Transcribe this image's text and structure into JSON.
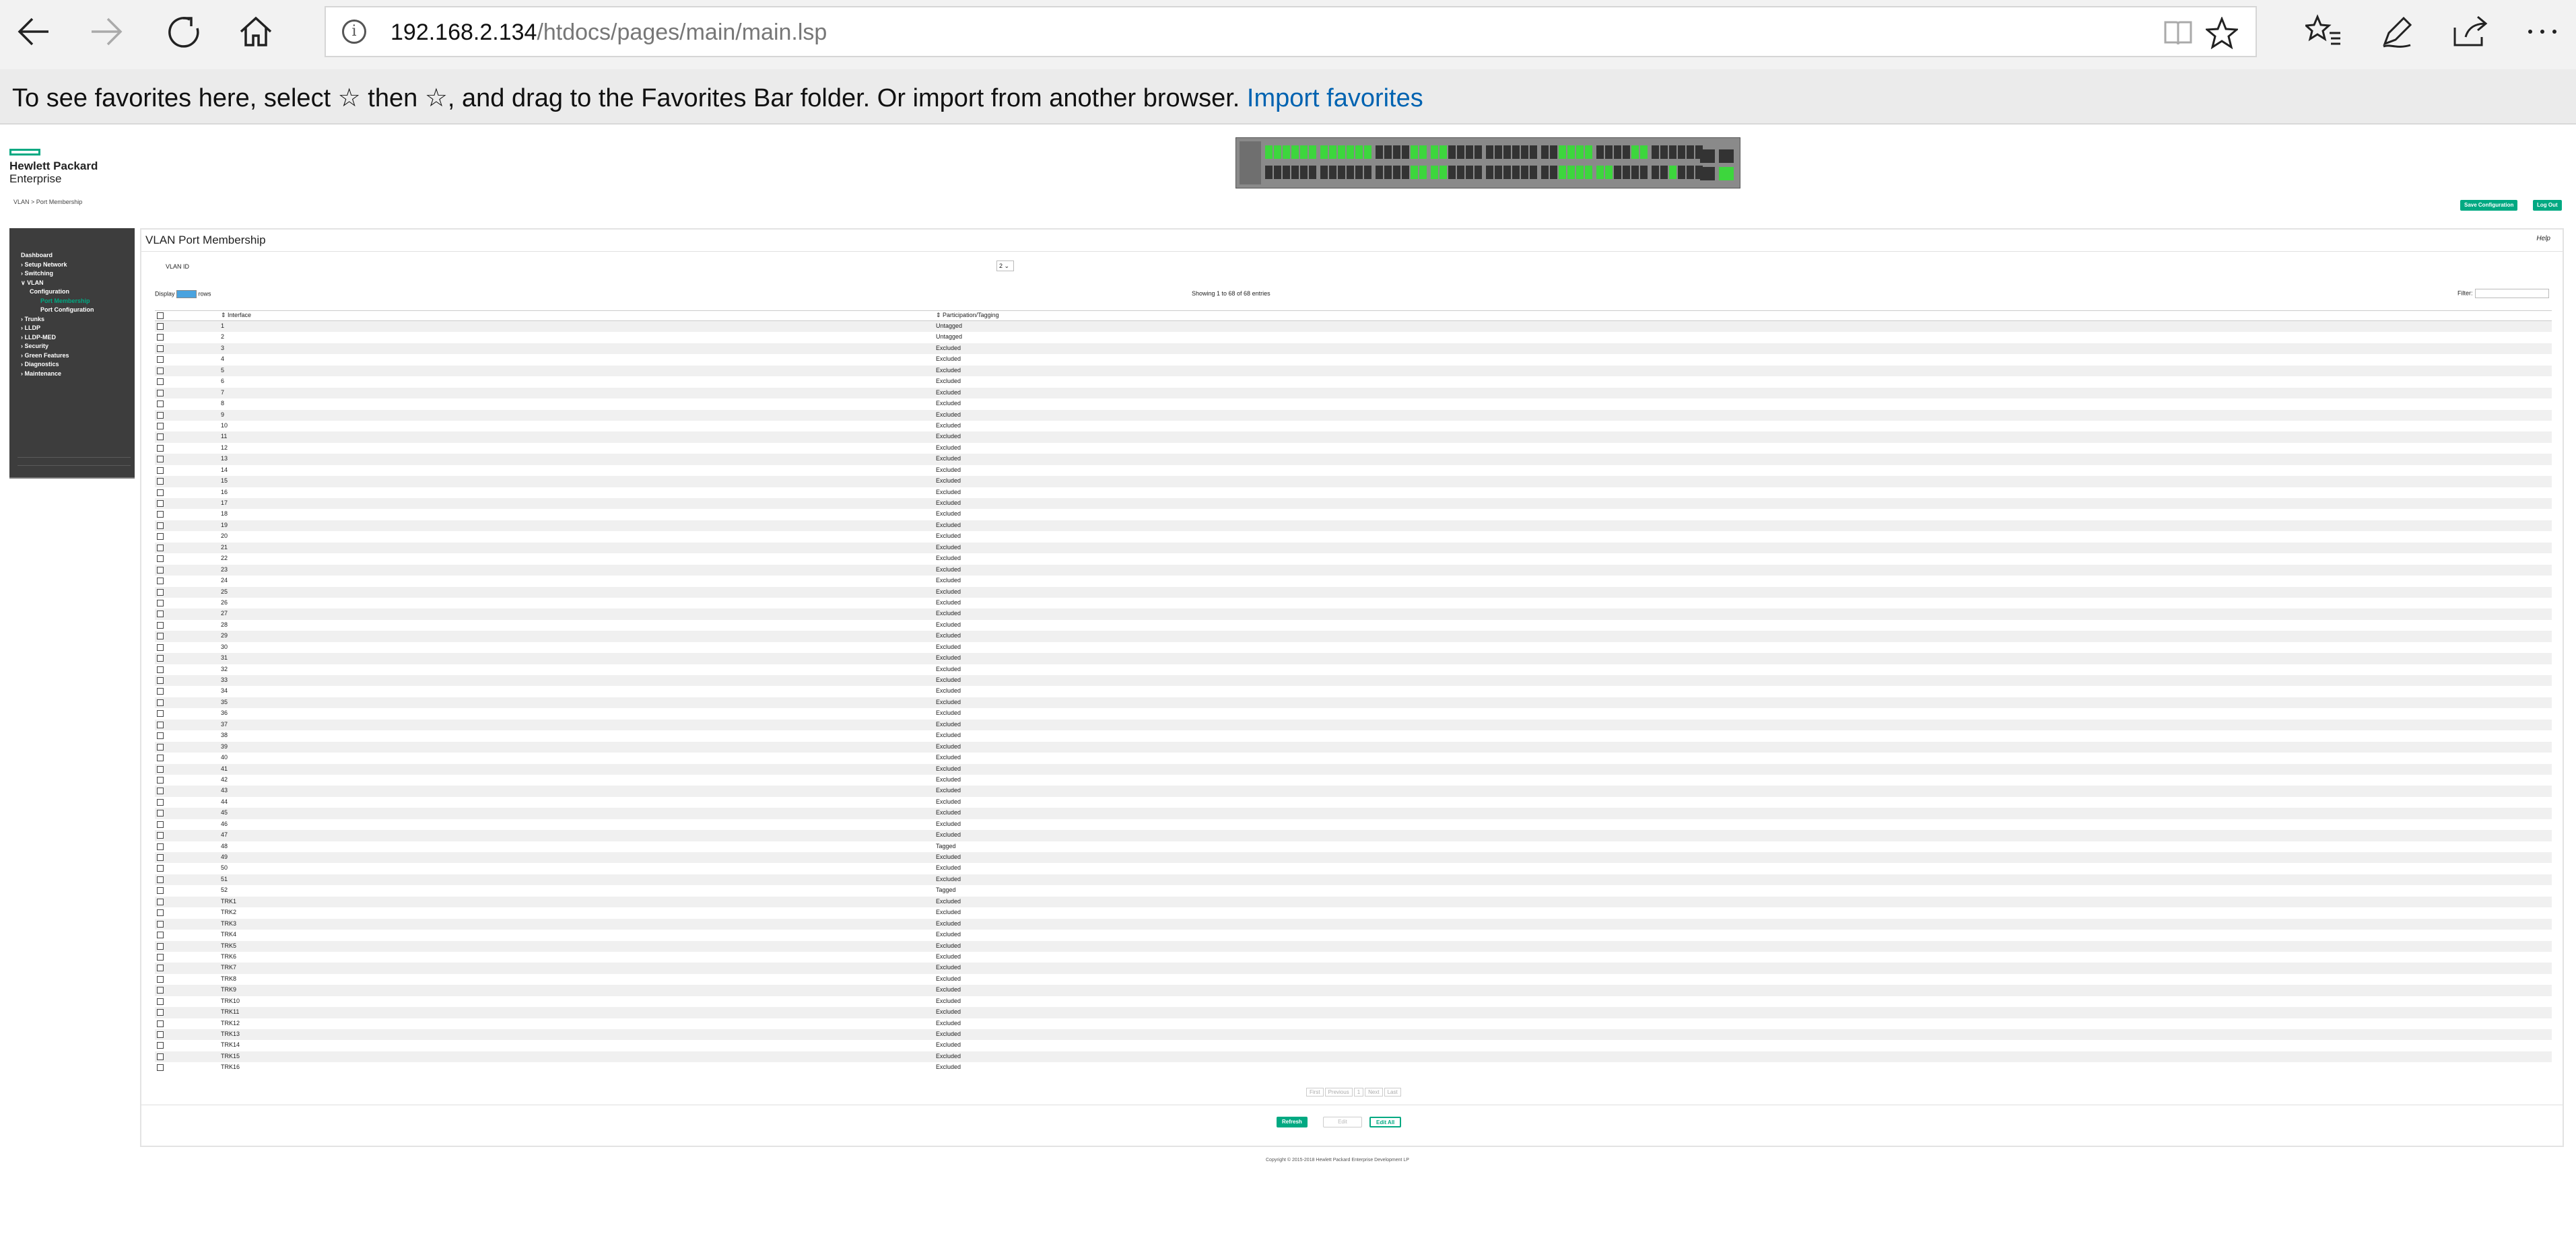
{
  "browser": {
    "url_host": "192.168.2.134",
    "url_path": "/htdocs/pages/main/main.lsp",
    "favorites_message": "To see favorites here, select ☆ then ☆, and drag to the Favorites Bar folder. Or import from another browser.",
    "import_link": "Import favorites"
  },
  "header": {
    "logo_line1": "Hewlett Packard",
    "logo_line2": "Enterprise",
    "breadcrumb": "VLAN > Port Membership",
    "save_button": "Save Configuration",
    "logout_button": "Log Out"
  },
  "sidebar": {
    "items": [
      {
        "label": "Dashboard",
        "level": 0
      },
      {
        "label": "› Setup Network",
        "level": 0
      },
      {
        "label": "› Switching",
        "level": 0
      },
      {
        "label": "∨ VLAN",
        "level": 0
      },
      {
        "label": "Configuration",
        "level": 1
      },
      {
        "label": "Port Membership",
        "level": 2,
        "active": true
      },
      {
        "label": "Port Configuration",
        "level": 2
      },
      {
        "label": "› Trunks",
        "level": 0
      },
      {
        "label": "› LLDP",
        "level": 0
      },
      {
        "label": "› LLDP-MED",
        "level": 0
      },
      {
        "label": "› Security",
        "level": 0
      },
      {
        "label": "› Green Features",
        "level": 0
      },
      {
        "label": "› Diagnostics",
        "level": 0
      },
      {
        "label": "› Maintenance",
        "level": 0
      }
    ]
  },
  "main": {
    "title": "VLAN Port Membership",
    "help": "Help",
    "vlan_id_label": "VLAN ID",
    "vlan_id_value": "2",
    "display_label": "Display",
    "display_value": "All",
    "rows_label": "rows",
    "showing": "Showing 1 to 68 of 68 entries",
    "filter_label": "Filter:",
    "columns": [
      "Interface",
      "Participation/Tagging"
    ],
    "rows": [
      [
        "1",
        "Untagged"
      ],
      [
        "2",
        "Untagged"
      ],
      [
        "3",
        "Excluded"
      ],
      [
        "4",
        "Excluded"
      ],
      [
        "5",
        "Excluded"
      ],
      [
        "6",
        "Excluded"
      ],
      [
        "7",
        "Excluded"
      ],
      [
        "8",
        "Excluded"
      ],
      [
        "9",
        "Excluded"
      ],
      [
        "10",
        "Excluded"
      ],
      [
        "11",
        "Excluded"
      ],
      [
        "12",
        "Excluded"
      ],
      [
        "13",
        "Excluded"
      ],
      [
        "14",
        "Excluded"
      ],
      [
        "15",
        "Excluded"
      ],
      [
        "16",
        "Excluded"
      ],
      [
        "17",
        "Excluded"
      ],
      [
        "18",
        "Excluded"
      ],
      [
        "19",
        "Excluded"
      ],
      [
        "20",
        "Excluded"
      ],
      [
        "21",
        "Excluded"
      ],
      [
        "22",
        "Excluded"
      ],
      [
        "23",
        "Excluded"
      ],
      [
        "24",
        "Excluded"
      ],
      [
        "25",
        "Excluded"
      ],
      [
        "26",
        "Excluded"
      ],
      [
        "27",
        "Excluded"
      ],
      [
        "28",
        "Excluded"
      ],
      [
        "29",
        "Excluded"
      ],
      [
        "30",
        "Excluded"
      ],
      [
        "31",
        "Excluded"
      ],
      [
        "32",
        "Excluded"
      ],
      [
        "33",
        "Excluded"
      ],
      [
        "34",
        "Excluded"
      ],
      [
        "35",
        "Excluded"
      ],
      [
        "36",
        "Excluded"
      ],
      [
        "37",
        "Excluded"
      ],
      [
        "38",
        "Excluded"
      ],
      [
        "39",
        "Excluded"
      ],
      [
        "40",
        "Excluded"
      ],
      [
        "41",
        "Excluded"
      ],
      [
        "42",
        "Excluded"
      ],
      [
        "43",
        "Excluded"
      ],
      [
        "44",
        "Excluded"
      ],
      [
        "45",
        "Excluded"
      ],
      [
        "46",
        "Excluded"
      ],
      [
        "47",
        "Excluded"
      ],
      [
        "48",
        "Tagged"
      ],
      [
        "49",
        "Excluded"
      ],
      [
        "50",
        "Excluded"
      ],
      [
        "51",
        "Excluded"
      ],
      [
        "52",
        "Tagged"
      ],
      [
        "TRK1",
        "Excluded"
      ],
      [
        "TRK2",
        "Excluded"
      ],
      [
        "TRK3",
        "Excluded"
      ],
      [
        "TRK4",
        "Excluded"
      ],
      [
        "TRK5",
        "Excluded"
      ],
      [
        "TRK6",
        "Excluded"
      ],
      [
        "TRK7",
        "Excluded"
      ],
      [
        "TRK8",
        "Excluded"
      ],
      [
        "TRK9",
        "Excluded"
      ],
      [
        "TRK10",
        "Excluded"
      ],
      [
        "TRK11",
        "Excluded"
      ],
      [
        "TRK12",
        "Excluded"
      ],
      [
        "TRK13",
        "Excluded"
      ],
      [
        "TRK14",
        "Excluded"
      ],
      [
        "TRK15",
        "Excluded"
      ],
      [
        "TRK16",
        "Excluded"
      ]
    ],
    "pager": [
      "First",
      "Previous",
      "1",
      "Next",
      "Last"
    ],
    "refresh_button": "Refresh",
    "edit_button": "Edit",
    "edit_all_button": "Edit All"
  },
  "footer": {
    "copyright": "Copyright © 2015-2018 Hewlett Packard Enterprise Development LP"
  },
  "colors": {
    "accent": "#01a982",
    "sidebar_bg": "#3d3d3d",
    "link": "#0063b1"
  }
}
